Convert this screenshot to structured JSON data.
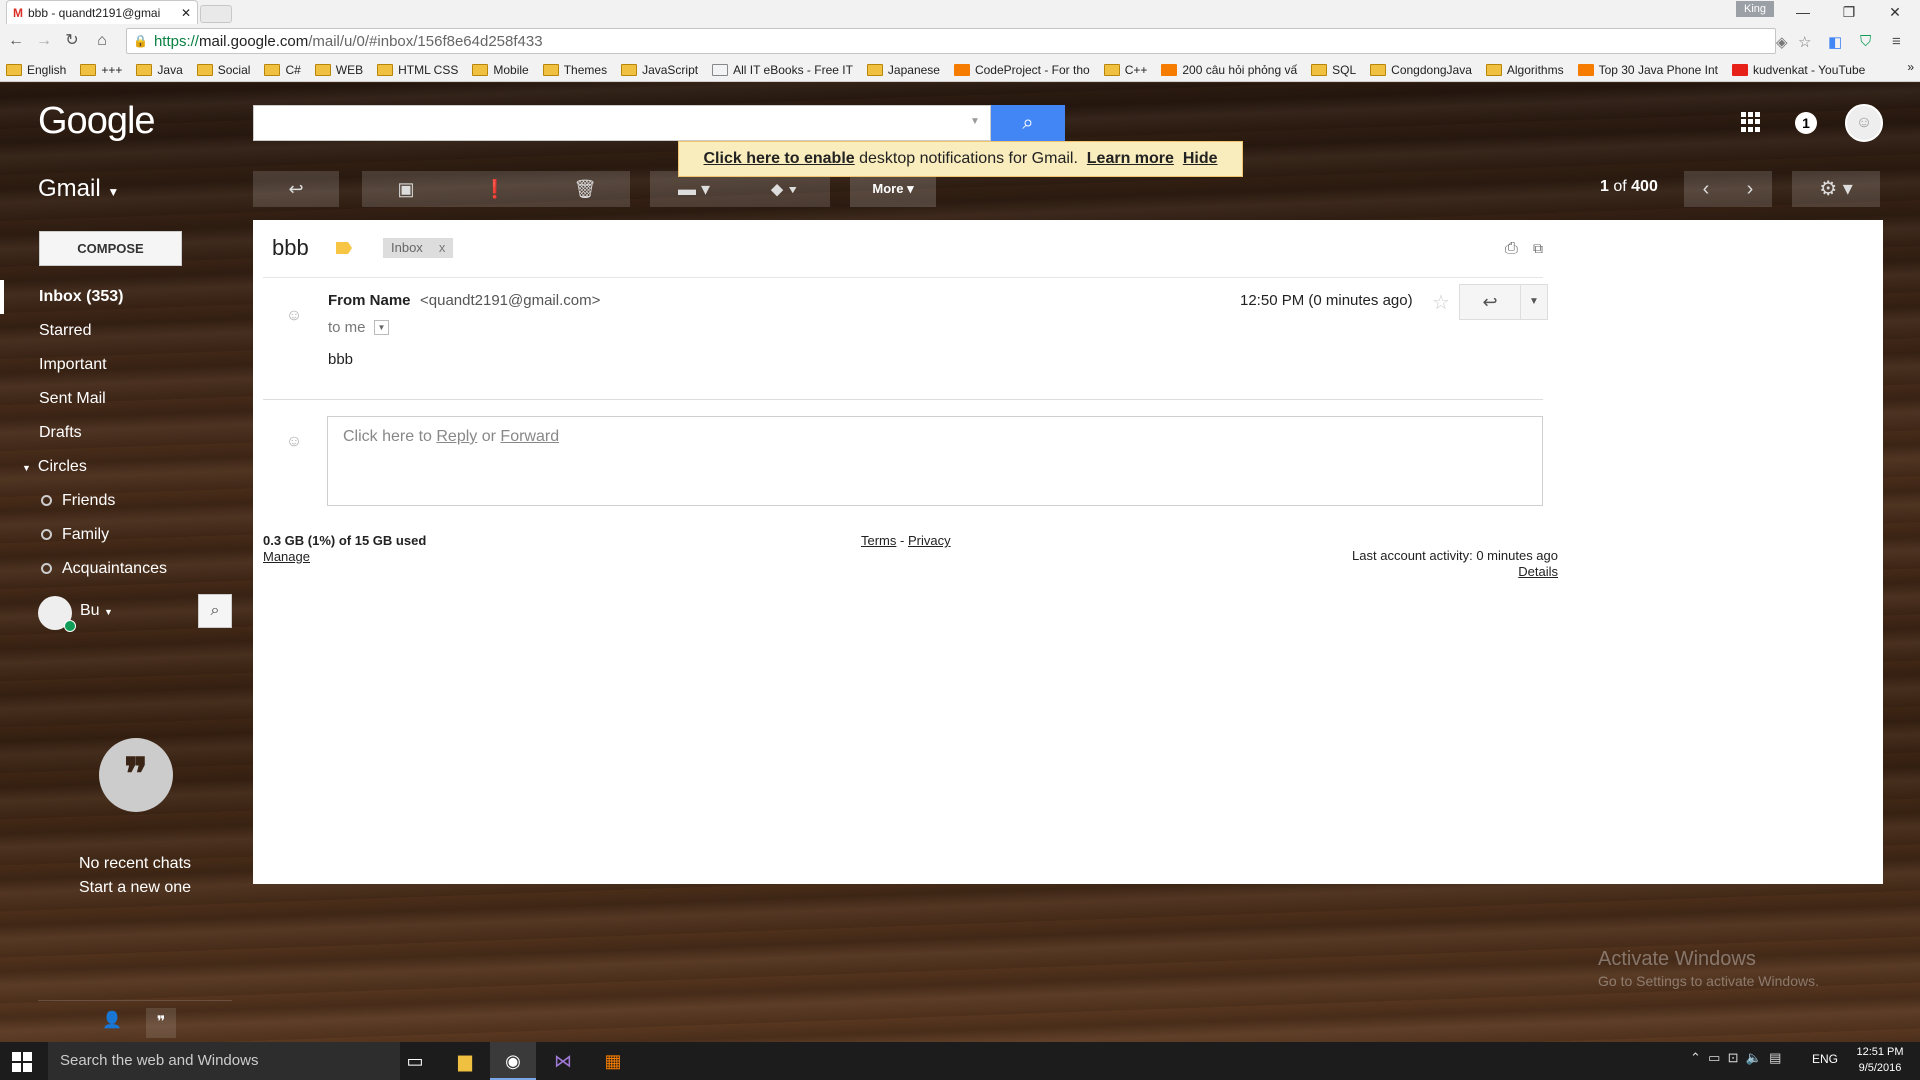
{
  "browser": {
    "tab_title": "bbb - quandt2191@gmai",
    "tab_favicon": "M",
    "profile_name": "King",
    "url_scheme": "https://",
    "url_host": "mail.google.com",
    "url_path": "/mail/u/0/#inbox/156f8e64d258f433",
    "bookmarks": [
      "English",
      "+++",
      "Java",
      "Social",
      "C#",
      "WEB",
      "HTML CSS",
      "Mobile",
      "Themes",
      "JavaScript",
      "All IT eBooks - Free IT",
      "Japanese",
      "CodeProject - For tho",
      "C++",
      "200 câu hỏi phỏng vấ",
      "SQL",
      "CongdongJava",
      "Algorithms",
      "Top 30 Java Phone Int",
      "kudvenkat - YouTube"
    ],
    "bookmarks_more": "»"
  },
  "header": {
    "logo": "Google",
    "app_label": "Gmail",
    "notification_count": "1",
    "banner": {
      "enable_link": "Click here to enable",
      "text": "desktop notifications for Gmail.",
      "learn_more": "Learn more",
      "hide": "Hide"
    }
  },
  "toolbar": {
    "more_label": "More",
    "count_current": "1",
    "count_of": "of",
    "count_total": "400"
  },
  "sidebar": {
    "compose_label": "COMPOSE",
    "items": [
      {
        "label": "Inbox (353)",
        "active": true
      },
      {
        "label": "Starred"
      },
      {
        "label": "Important"
      },
      {
        "label": "Sent Mail"
      },
      {
        "label": "Drafts"
      },
      {
        "label": "Circles"
      },
      {
        "label": "Friends"
      },
      {
        "label": "Family"
      },
      {
        "label": "Acquaintances"
      }
    ],
    "hangouts_user": "Bu",
    "no_chats": "No recent chats",
    "start_new": "Start a new one"
  },
  "message": {
    "subject": "bbb",
    "label_chip": "Inbox",
    "label_chip_close": "x",
    "from_name": "From Name",
    "from_email": "<quandt2191@gmail.com>",
    "to": "to me",
    "time": "12:50 PM (0 minutes ago)",
    "body": "bbb",
    "reply_prompt": "Click here to",
    "reply_link": "Reply",
    "reply_or": "or",
    "forward_link": "Forward"
  },
  "footer": {
    "storage": "0.3 GB (1%) of 15 GB used",
    "manage": "Manage",
    "terms": "Terms",
    "sep": "-",
    "privacy": "Privacy",
    "activity": "Last account activity: 0 minutes ago",
    "details": "Details"
  },
  "watermark": {
    "line1": "Activate Windows",
    "line2": "Go to Settings to activate Windows."
  },
  "taskbar": {
    "search_placeholder": "Search the web and Windows",
    "lang": "ENG",
    "time": "12:51 PM",
    "date": "9/5/2016"
  }
}
